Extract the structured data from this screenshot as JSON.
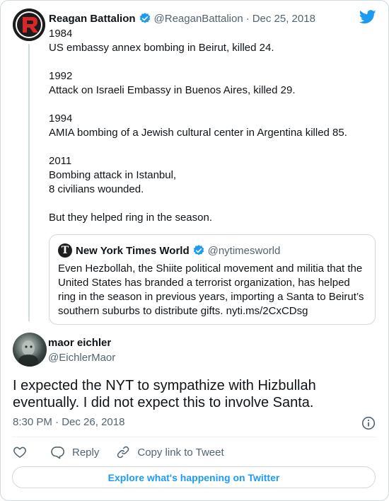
{
  "parent_tweet": {
    "name": "Reagan Battalion",
    "handle": "@ReaganBattalion",
    "separator": "·",
    "date": "Dec 25, 2018",
    "lines": [
      "1984",
      "US embassy annex bombing in Beirut, killed 24.",
      "",
      "1992",
      "Attack on Israeli Embassy in Buenos Aires, killed 29.",
      "",
      "1994",
      "AMIA bombing of a Jewish cultural center in Argentina killed 85.",
      "",
      "2011",
      "Bombing attack in Istanbul,",
      "8 civilians wounded.",
      "",
      "But they helped ring in the season."
    ]
  },
  "quoted_tweet": {
    "name": "New York Times World",
    "handle": "@nytimesworld",
    "logo_letter": "T",
    "text": "Even Hezbollah, the Shiite political movement and militia that the United States has branded a terrorist organization, has helped ring in the season in previous years, importing a Santa to Beirut’s southern suburbs to distribute gifts. nyti.ms/2CxCDsg"
  },
  "reply_tweet": {
    "name": "maor eichler",
    "handle": "@EichlerMaor",
    "text_lines": [
      "I expected the NYT to sympathize with Hizbullah",
      "eventually. I did not expect this to involve Santa."
    ],
    "time": "8:30 PM",
    "separator": "·",
    "date": "Dec 26, 2018"
  },
  "actions": {
    "like_icon": "heart-icon",
    "reply_label": "Reply",
    "copy_link_label": "Copy link to Tweet"
  },
  "explore_label": "Explore what's happening on Twitter",
  "colors": {
    "accent": "#1d9bf0",
    "text": "#0f1419",
    "muted": "#536471",
    "border": "#cfd9de",
    "reagan_logo_red": "#d62828"
  }
}
